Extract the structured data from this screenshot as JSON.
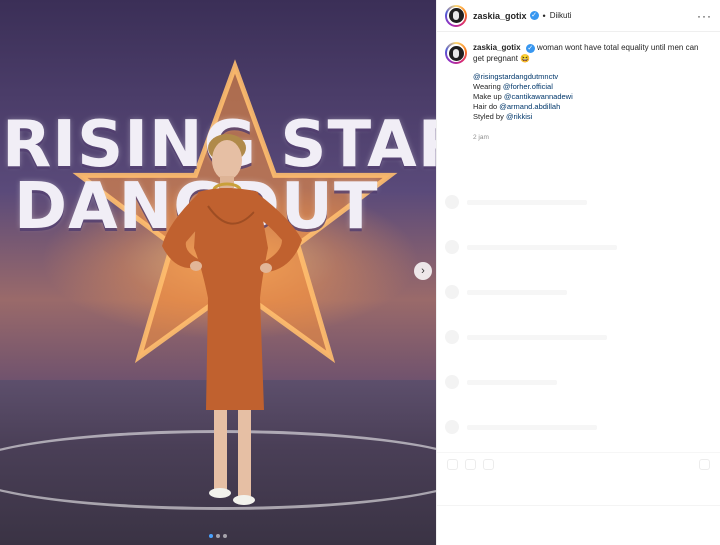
{
  "post": {
    "username": "zaskia_gotix",
    "verified_mark": "✓",
    "separator": "•",
    "follow_status": "Diikuti",
    "more_label": "···"
  },
  "caption": {
    "username": "zaskia_gotix",
    "text": "woman wont have total equality until men can get pregnant",
    "emoji": "😆",
    "mention_line": "@risingstardangdutmnctv",
    "wearing_label": "Wearing ",
    "wearing_handle": "@forher.official",
    "makeup_label": "Make up ",
    "makeup_handle": "@cantikawannadewi",
    "hair_label": "Hair do ",
    "hair_handle": "@armand.abdillah",
    "styled_label": "Styled by ",
    "styled_handle": "@rikkisi",
    "time": "2 jam"
  },
  "photo": {
    "logo_line1": "RISING STAR",
    "logo_line2": "DANGDUT",
    "next_icon": "chevron-right-icon",
    "next_glyph": "›",
    "carousel_count": 3,
    "carousel_active": 1
  },
  "colors": {
    "verified": "#3897f0",
    "link": "#00376b",
    "dress": "#c0612f",
    "active_dot": "#4aa3ff"
  }
}
